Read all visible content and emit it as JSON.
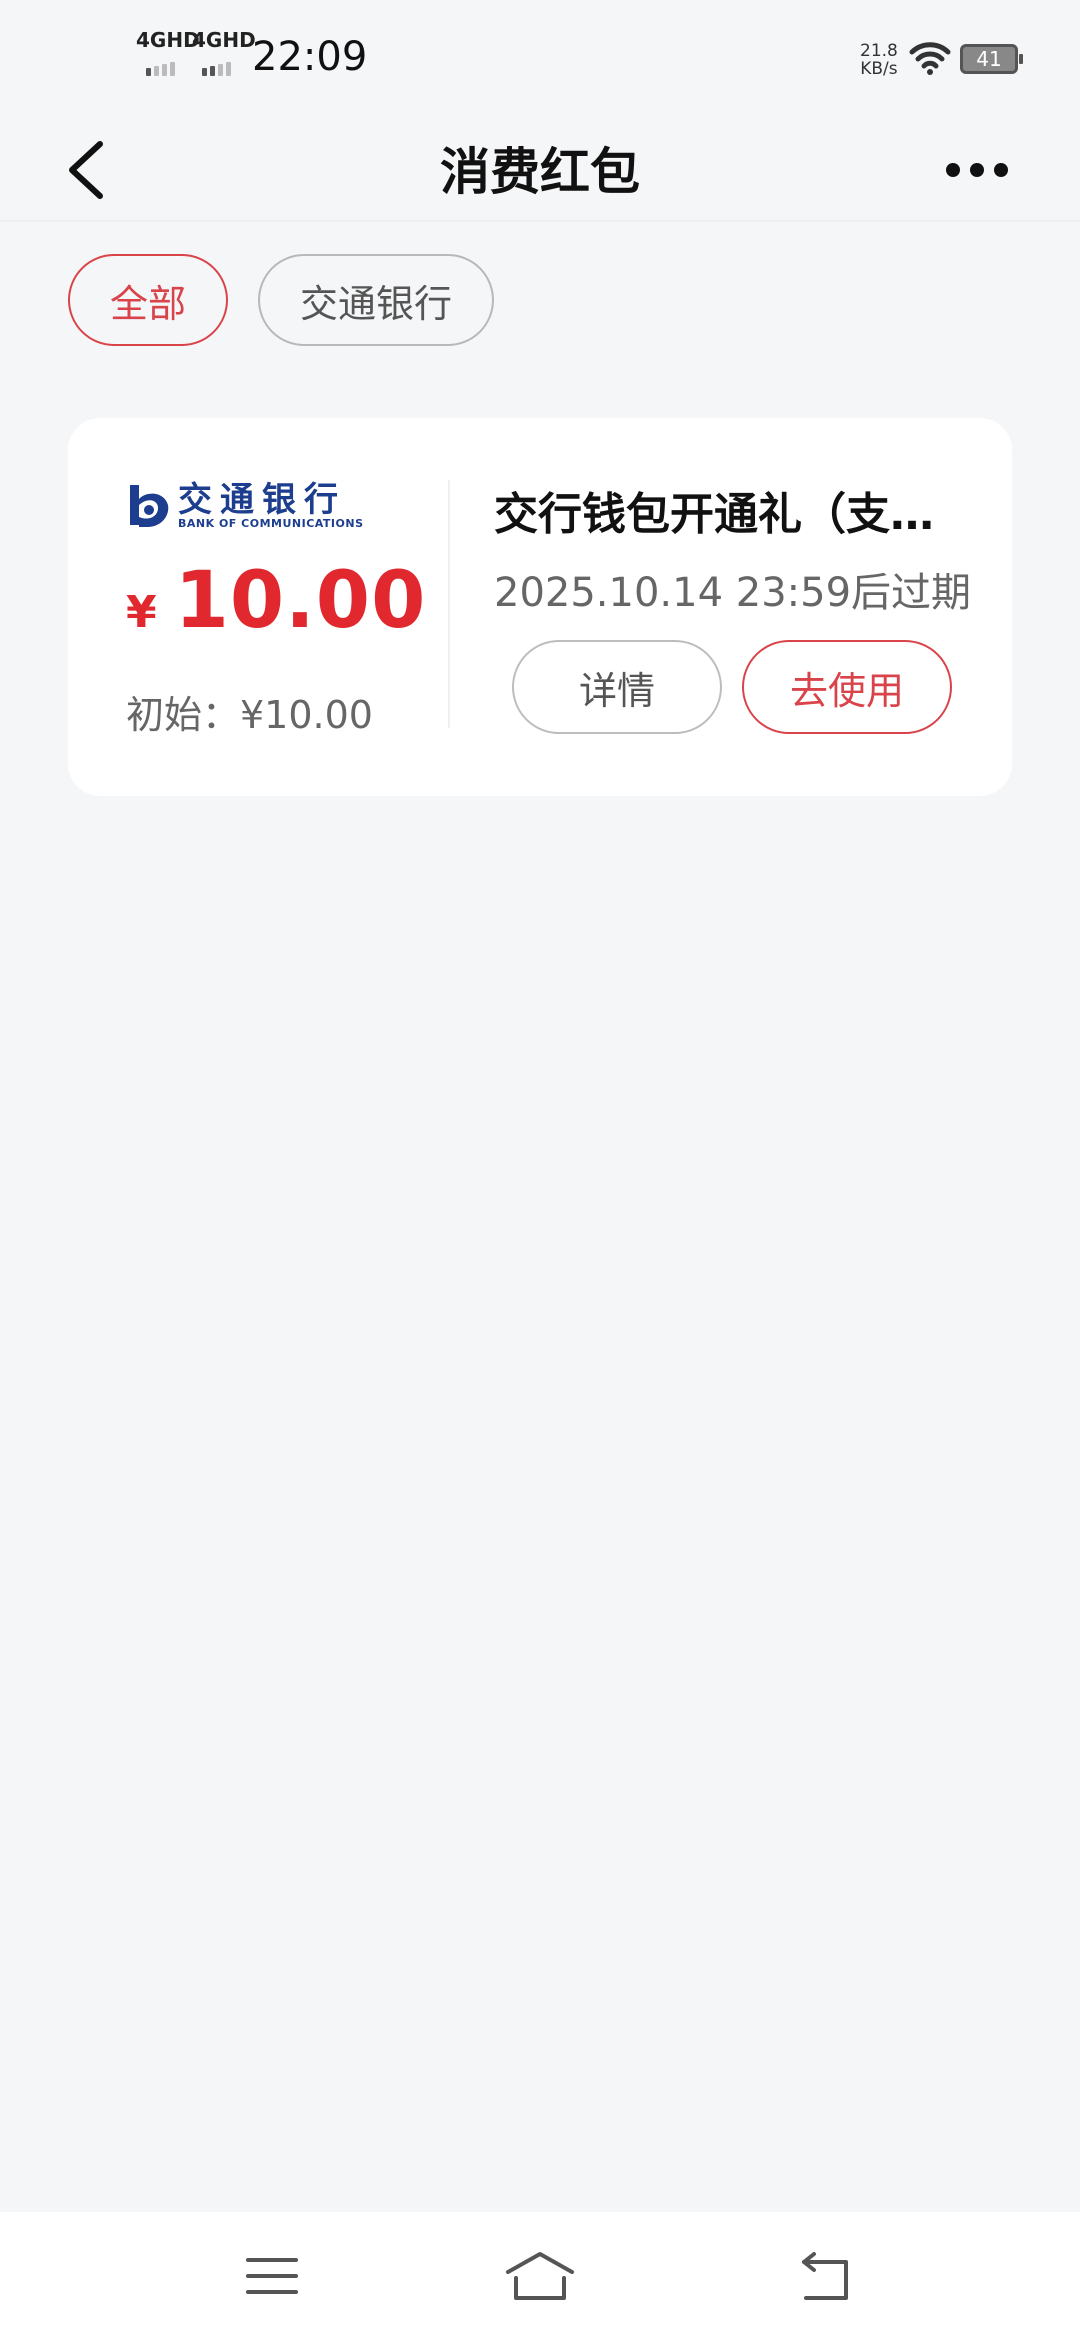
{
  "status_bar": {
    "network_1": "4GHD",
    "network_2": "4GHD",
    "time": "22:09",
    "speed_value": "21.8",
    "speed_unit": "KB/s",
    "battery": "41"
  },
  "header": {
    "title": "消费红包"
  },
  "filters": [
    {
      "label": "全部",
      "active": true
    },
    {
      "label": "交通银行",
      "active": false
    }
  ],
  "coupon": {
    "bank_name_cn": "交通银行",
    "bank_name_en": "BANK OF COMMUNICATIONS",
    "currency": "¥",
    "amount": "10.00",
    "initial": "初始：¥10.00",
    "name": "交行钱包开通礼（支…",
    "expiry": "2025.10.14 23:59后过期",
    "detail_label": "详情",
    "use_label": "去使用"
  },
  "colors": {
    "accent_red": "#e0282e",
    "chip_red": "#d9434a",
    "bank_blue": "#1d3d8f",
    "background": "#f5f6f8"
  }
}
